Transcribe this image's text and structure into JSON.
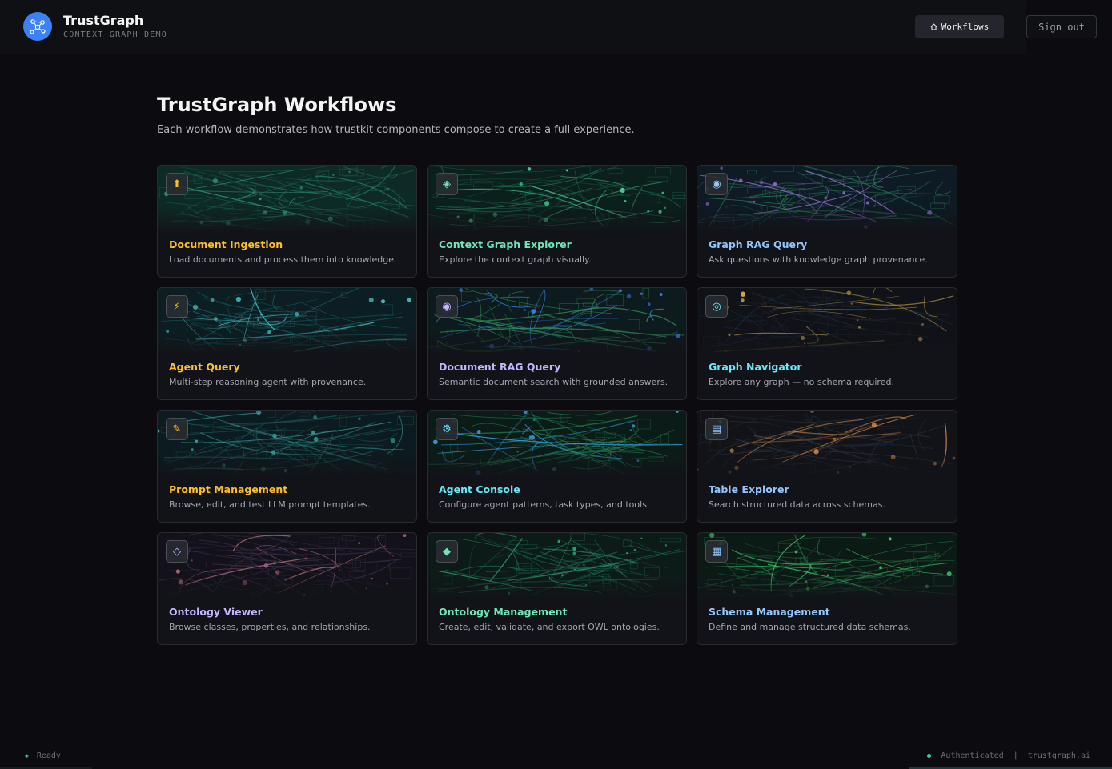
{
  "header": {
    "brand_title": "TrustGraph",
    "brand_subtitle": "CONTEXT GRAPH DEMO",
    "workflows_label": "Workflows",
    "workflows_icon": "home-icon",
    "signout_label": "Sign out"
  },
  "main": {
    "title": "TrustGraph Workflows",
    "subtitle": "Each workflow demonstrates how trustkit components compose to create a full experience."
  },
  "cards": [
    {
      "title": "Document Ingestion",
      "desc": "Load documents and process them into knowledge.",
      "icon": "⬆",
      "icon_name": "upload-icon",
      "color": "#fbbf24"
    },
    {
      "title": "Context Graph Explorer",
      "desc": "Explore the context graph visually.",
      "icon": "◈",
      "icon_name": "diamond-icon",
      "color": "#6ee7b7"
    },
    {
      "title": "Graph RAG Query",
      "desc": "Ask questions with knowledge graph provenance.",
      "icon": "◉",
      "icon_name": "target-icon",
      "color": "#93c5fd"
    },
    {
      "title": "Agent Query",
      "desc": "Multi-step reasoning agent with provenance.",
      "icon": "⚡",
      "icon_name": "lightning-icon",
      "color": "#fbbf24"
    },
    {
      "title": "Document RAG Query",
      "desc": "Semantic document search with grounded answers.",
      "icon": "◉",
      "icon_name": "target-icon",
      "color": "#c4b5fd"
    },
    {
      "title": "Graph Navigator",
      "desc": "Explore any graph — no schema required.",
      "icon": "◎",
      "icon_name": "compass-icon",
      "color": "#67e8f9"
    },
    {
      "title": "Prompt Management",
      "desc": "Browse, edit, and test LLM prompt templates.",
      "icon": "✎",
      "icon_name": "pencil-icon",
      "color": "#fbbf24"
    },
    {
      "title": "Agent Console",
      "desc": "Configure agent patterns, task types, and tools.",
      "icon": "⚙",
      "icon_name": "gear-icon",
      "color": "#67e8f9"
    },
    {
      "title": "Table Explorer",
      "desc": "Search structured data across schemas.",
      "icon": "▤",
      "icon_name": "table-icon",
      "color": "#93c5fd"
    },
    {
      "title": "Ontology Viewer",
      "desc": "Browse classes, properties, and relationships.",
      "icon": "◇",
      "icon_name": "diamond-outline-icon",
      "color": "#c4b5fd"
    },
    {
      "title": "Ontology Management",
      "desc": "Create, edit, validate, and export OWL ontologies.",
      "icon": "◆",
      "icon_name": "diamond-filled-icon",
      "color": "#6ee7b7"
    },
    {
      "title": "Schema Management",
      "desc": "Define and manage structured data schemas.",
      "icon": "▦",
      "icon_name": "grid-icon",
      "color": "#93c5fd"
    }
  ],
  "status": {
    "left": "Ready",
    "auth": "Authenticated",
    "separator": "|",
    "domain": "trustgraph.ai"
  },
  "colors": {
    "background": "#0c0c10",
    "accent": "#3b82f6",
    "status_ok": "#34d399"
  }
}
